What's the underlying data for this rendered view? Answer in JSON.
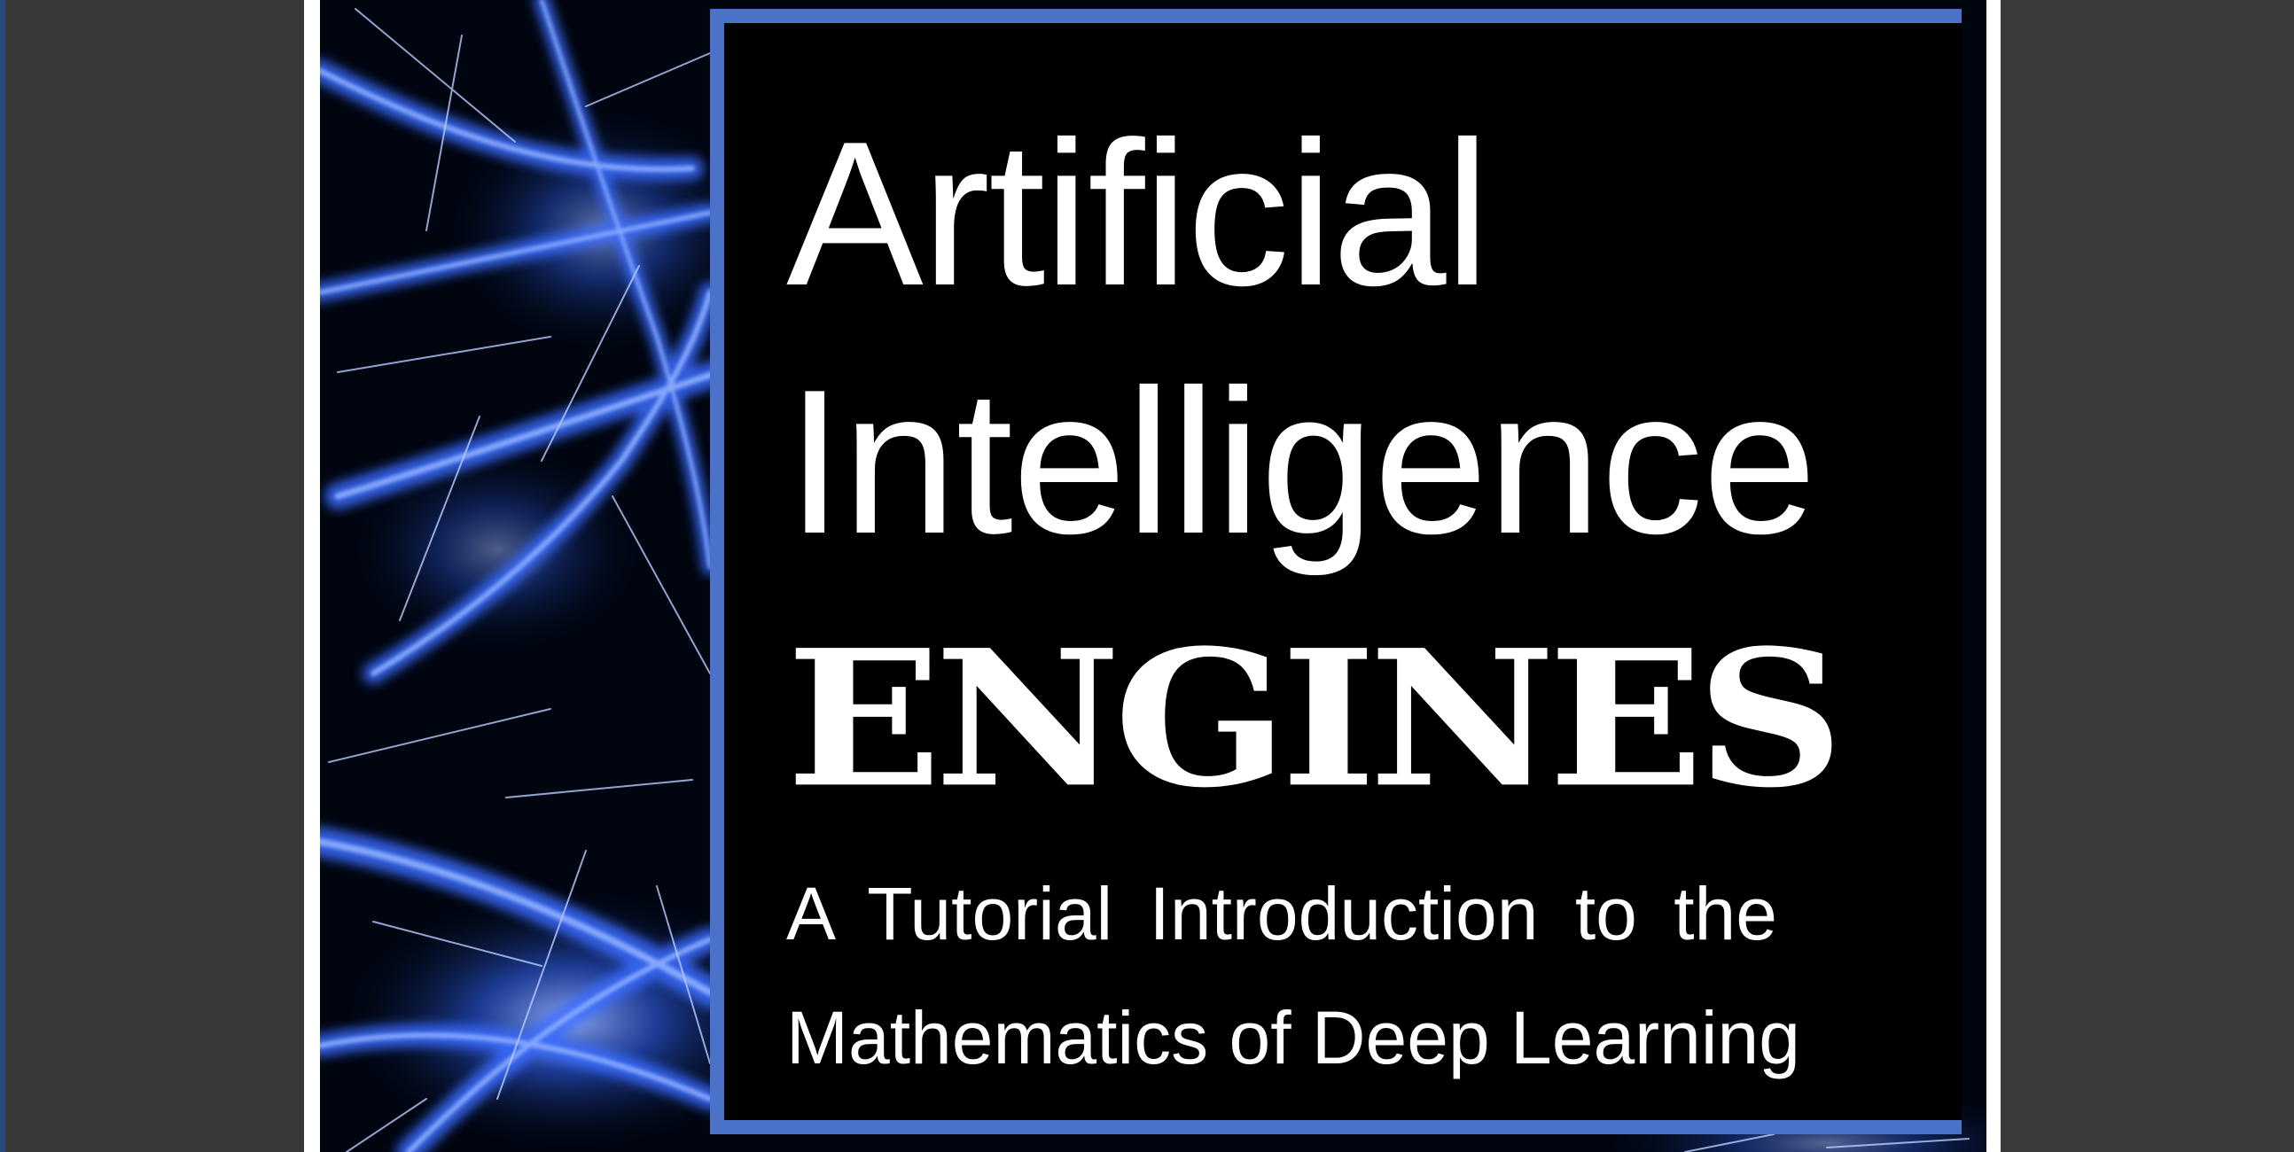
{
  "document": {
    "cover": {
      "title_line1": "Artificial",
      "title_line2": "Intelligence",
      "title_line3": "ENGINES",
      "subtitle_line1": "A Tutorial Introduction to the",
      "subtitle_line2": "Mathematics of Deep Learning"
    }
  },
  "colors": {
    "viewer_background": "#383838",
    "panel_border": "#4a72c8",
    "neuron_glow": "#3a6cff",
    "text": "#ffffff"
  },
  "icons": {
    "cover_art": "neuron-network-image"
  }
}
